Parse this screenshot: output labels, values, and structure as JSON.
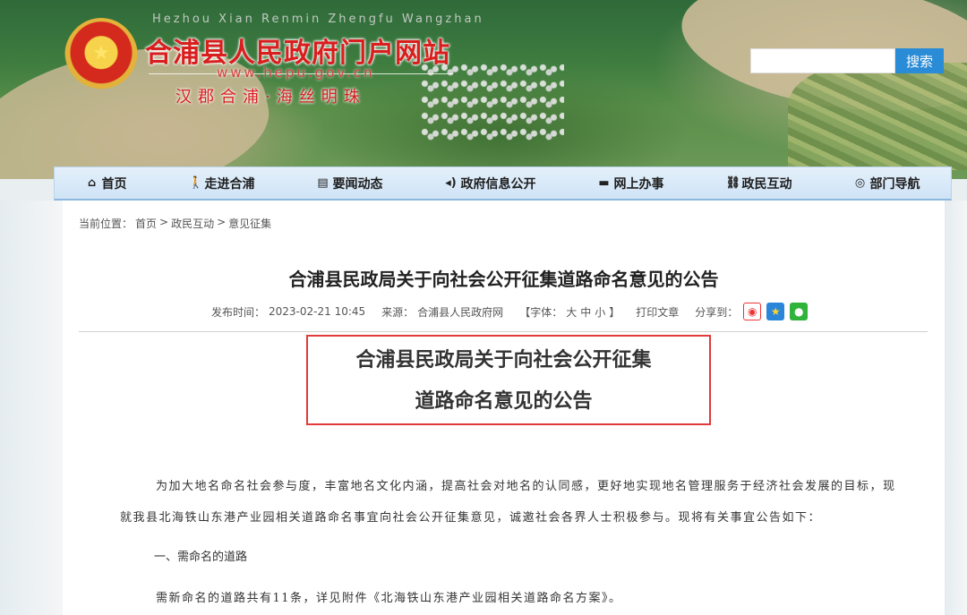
{
  "header": {
    "site_title": "合浦县人民政府门户网站",
    "site_pinyin": "Hezhou Xian Renmin Zhengfu Wangzhan",
    "site_url": "www.hepu.gov.cn",
    "slogan": "汉郡合浦·海丝明珠",
    "search": {
      "placeholder": "",
      "button_label": "搜索"
    }
  },
  "nav": {
    "items": [
      {
        "label": "首页",
        "icon": "home-icon"
      },
      {
        "label": "走进合浦",
        "icon": "walk-icon"
      },
      {
        "label": "要闻动态",
        "icon": "document-icon"
      },
      {
        "label": "政府信息公开",
        "icon": "speaker-icon"
      },
      {
        "label": "网上办事",
        "icon": "monitor-icon"
      },
      {
        "label": "政民互动",
        "icon": "link-icon"
      },
      {
        "label": "部门导航",
        "icon": "compass-icon"
      }
    ]
  },
  "breadcrumb": {
    "prefix": "当前位置：",
    "items": [
      "首页",
      "政民互动",
      "意见征集"
    ],
    "separator": ">"
  },
  "article": {
    "title": "合浦县民政局关于向社会公开征集道路命名意见的公告",
    "meta": {
      "publish_label": "发布时间：",
      "publish_time": "2023-02-21 10:45",
      "source_label": "来源：",
      "source": "合浦县人民政府网",
      "font_label": "【字体：",
      "font_large": "大",
      "font_medium": "中",
      "font_small": "小",
      "font_close": "】",
      "print_label": "打印文章",
      "share_label": "分享到："
    },
    "body_title_line1": "合浦县民政局关于向社会公开征集",
    "body_title_line2": "道路命名意见的公告",
    "paragraph1_line1": "为加大地名命名社会参与度，丰富地名文化内涵，提高社会对地名的认同感，更好地实现地名管理服务于经济社会发展的目标，现",
    "paragraph1_line2": "就我县北海铁山东港产业园相关道路命名事宜向社会公开征集意见，诚邀社会各界人士积极参与。现将有关事宜公告如下：",
    "section1_heading": "一、需命名的道路",
    "section1_text": "需新命名的道路共有11条，详见附件《北海铁山东港产业园相关道路命名方案》。"
  },
  "colors": {
    "title_red": "#d91e1e",
    "search_blue": "#2a8bd6",
    "highlight_border": "#e03a3a"
  }
}
